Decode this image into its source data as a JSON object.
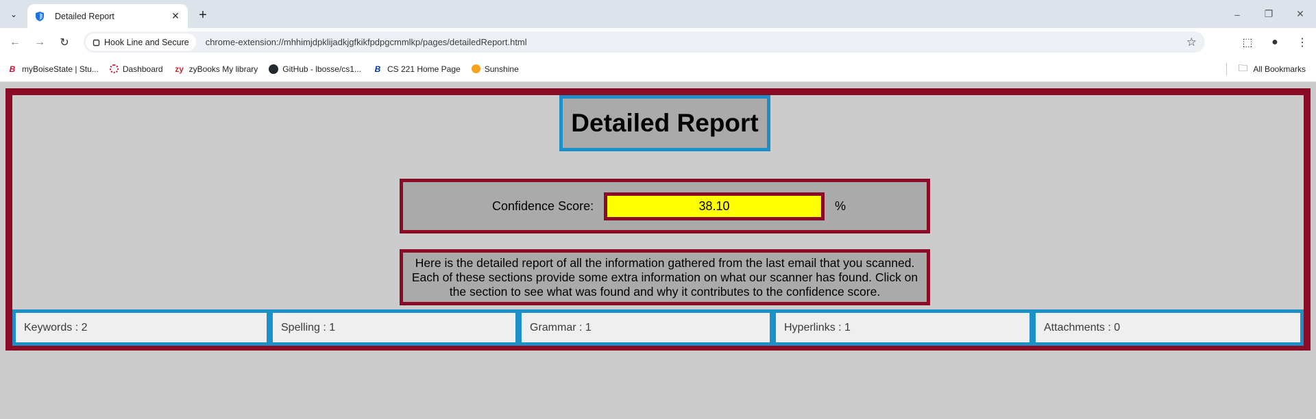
{
  "browser": {
    "tab_title": "Detailed Report",
    "site_chip": "Hook Line and Secure",
    "url": "chrome-extension://mhhimjdpklijadkjgfkikfpdpgcmmlkp/pages/detailedReport.html",
    "bookmarks": [
      {
        "label": "myBoiseState | Stu...",
        "icon": "boise-state-icon"
      },
      {
        "label": "Dashboard",
        "icon": "dashboard-icon"
      },
      {
        "label": "zyBooks My library",
        "icon": "zybooks-icon"
      },
      {
        "label": "GitHub - lbosse/cs1...",
        "icon": "github-icon"
      },
      {
        "label": "CS 221 Home Page",
        "icon": "boise-state-icon"
      },
      {
        "label": "Sunshine",
        "icon": "sunshine-icon"
      }
    ],
    "all_bookmarks": "All Bookmarks"
  },
  "report": {
    "title": "Detailed Report",
    "score_label": "Confidence Score:",
    "score_value": "38.10",
    "score_unit": "%",
    "description": "Here is the detailed report of all the information gathered from the last email that you scanned. Each of these sections provide some extra information on what our scanner has found. Click on the section to see what was found and why it contributes to the confidence score.",
    "sections": [
      {
        "label": "Keywords : 2"
      },
      {
        "label": "Spelling : 1"
      },
      {
        "label": "Grammar : 1"
      },
      {
        "label": "Hyperlinks : 1"
      },
      {
        "label": "Attachments : 0"
      }
    ]
  },
  "colors": {
    "frame_border": "#8b0a26",
    "title_border": "#1e90c8",
    "score_fill": "#ffff00",
    "panel_bg": "#aaaaaa",
    "page_bg": "#cccccc"
  }
}
